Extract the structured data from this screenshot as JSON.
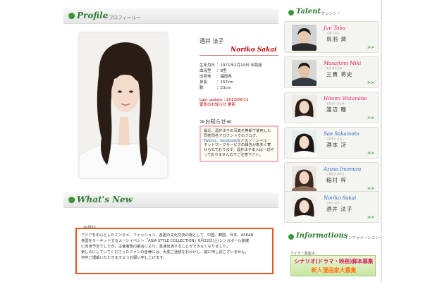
{
  "profile_section": {
    "title": "Profile",
    "subtitle": "ープロフィールー"
  },
  "profile": {
    "name_jp": "酒井 法子",
    "name_en": "Noriko Sakai",
    "details": [
      {
        "label": "生年月日",
        "value": "1971年2月14日 水瓶座"
      },
      {
        "label": "血液型",
        "value": "B型"
      },
      {
        "label": "出身地",
        "value": "福岡県"
      },
      {
        "label": "身長",
        "value": "157cm"
      },
      {
        "label": "靴",
        "value": "23cm"
      }
    ],
    "last_update": "Last update : 2013/06/11",
    "update_note": "緊急のお知らせ 更新"
  },
  "notice": {
    "title": "≫お知らせ≪",
    "text_1": "最近、酒井法子の写真を無断で使用した同姓同名アカウントでのブログ、",
    "link_1": "Twitter",
    "sep": "、",
    "link_2": "facebook",
    "text_2": "などのソーシャル・ネットワークサービスの報告が数多く寄せられております。酒井法子本人は一切やっておりませんのでご注意下さい。"
  },
  "whatsnew_section": {
    "title": "What's New"
  },
  "news": {
    "heading": "お詫び",
    "line_1": "アジアを中心としたエンタメ、ファッション、各国の文化交流の場として、中国、韓国、日本、ASEAN",
    "line_2": "各国をサーキットするメーンイベント「ASIA STYLE COLLECTION」6月22日(土)シンガポール開催",
    "line_3": "に出演予定でしたが、主催者側の都合により、急遽出演することができなくなりました。",
    "line_4": "楽しみにしていてくださったファンの皆様には、大変ご迷惑をおかけし、誠に申し訳ございません。",
    "line_5": "何卒ご理解いただきますようお願い申し上げます。"
  },
  "talent_section": {
    "title": "Talent",
    "subtitle": "ータレントー"
  },
  "talents": [
    {
      "en": "Jun Toba",
      "ruby": "とば じゅん",
      "jp": "鳥羽 潤",
      "more": ">>"
    },
    {
      "en": "Masafumi Miki",
      "ruby": "みき まさふみ",
      "jp": "三貴 将史",
      "more": ">>"
    },
    {
      "en": "Hitomi Watanabe",
      "ruby": "わたなべ ひとみ",
      "jp": "渡辺 瞳",
      "more": ">>"
    },
    {
      "en": "Sae Sakamoto",
      "ruby": "さかもと さえ",
      "jp": "酒本 冴",
      "more": ">>"
    },
    {
      "en": "Azusa Inamura",
      "ruby": "いなむら あずさ",
      "jp": "稲村 梓",
      "more": ">>"
    },
    {
      "en": "Noriko Sakai",
      "ruby": "さかい のりこ",
      "jp": "酒井 法子",
      "more": ">>"
    }
  ],
  "info_section": {
    "title": "Informations",
    "subtitle": "ーインフォメーションー"
  },
  "info": {
    "label": "ライター募集中",
    "banner_line_1": "シナリオ(ドラマ・映画)脚本募集",
    "banner_line_2": "新人漫画家大募集"
  },
  "colors": {
    "accent_green": "#2e7d32",
    "name_red": "#c00000",
    "notice_border": "#f4b8bf",
    "news_border": "#e8541e"
  }
}
